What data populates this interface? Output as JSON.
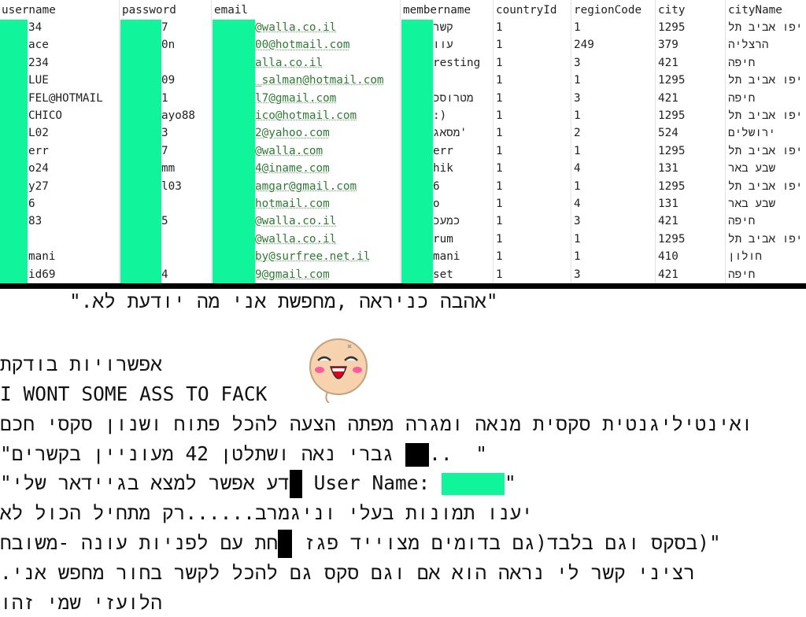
{
  "table": {
    "columns": [
      "username",
      "password",
      "email",
      "membername",
      "countryId",
      "regionCode",
      "city",
      "cityName"
    ],
    "rows": [
      [
        "34",
        "7",
        "@walla.co.il",
        "קשר",
        "1",
        "1",
        "1295",
        "תל אביב יפו"
      ],
      [
        "ace",
        "0n",
        "00@hotmail.com",
        "עוו",
        "1",
        "249",
        "379",
        "הרצליה"
      ],
      [
        "234",
        "",
        "alla.co.il",
        "resting",
        "1",
        "3",
        "421",
        "חיפה"
      ],
      [
        "LUE",
        "09",
        "_salman@hotmail.com",
        "",
        "1",
        "1",
        "1295",
        "תל אביב יפו"
      ],
      [
        "FEL@HOTMAIL",
        "1",
        "l7@gmail.com",
        "מטרוסכ",
        "1",
        "3",
        "421",
        "חיפה"
      ],
      [
        "CHICO",
        "ayo88",
        "ico@hotmail.com",
        ":)",
        "1",
        "1",
        "1295",
        "תל אביב יפו"
      ],
      [
        "L02",
        "3",
        "2@yahoo.com",
        "מסאג'",
        "1",
        "2",
        "524",
        "ירושלים"
      ],
      [
        "err",
        "7",
        "@walla.com",
        "err",
        "1",
        "1",
        "1295",
        "תל אביב יפו"
      ],
      [
        "o24",
        "mm",
        "4@iname.com",
        "hik",
        "1",
        "4",
        "131",
        "באר שבע"
      ],
      [
        "y27",
        "l03",
        "amgar@gmail.com",
        "6",
        "1",
        "1",
        "1295",
        "תל אביב יפו"
      ],
      [
        "6",
        "",
        "hotmail.com",
        "o",
        "1",
        "4",
        "131",
        "באר שבע"
      ],
      [
        "83",
        "5",
        "@walla.co.il",
        "כמעכ",
        "1",
        "3",
        "421",
        "חיפה"
      ],
      [
        "",
        "",
        "@walla.co.il",
        "rum",
        "1",
        "1",
        "1295",
        "תל אביב יפו"
      ],
      [
        "mani",
        "",
        "by@surfree.net.il",
        "mani",
        "1",
        "1",
        "410",
        "חולון"
      ],
      [
        "id69",
        "4",
        "9@gmail.com",
        "set",
        "1",
        "3",
        "421",
        "חיפה"
      ]
    ]
  },
  "profile_texts": {
    "line1": "\".לא יודעת מה אני מחפשת, כניראה אהבה\"",
    "line2": "בודקת אפשרויות",
    "line3": "I WONT SOME ASS TO FACK",
    "line4": "חכם סקסי ושנון פתוח להכל הצעה מפתה ומגרה מנאה סקסית ואינטיליגנטית",
    "line5a": "\"בקשרים מעוניין 42 ושתלטן נאה גברי",
    "line5b": "..  \"",
    "line6a": "\"שלי בגיידאר למצא אפשר דע",
    "line6b": "User Name:",
    "line6c": "\"",
    "line7": "לא הכול מתחיל וניגמרב......רק בעלי תמונות יענו",
    "line8a": "משובח- עונה לפניות עם חת",
    "line8b": "פגז מצוייד בדומים בלבד(גם וגם בסקס)\"",
    "line9": ".אני מחפש בחור לקשר להכל גם סקס וגם אם הוא נראה לי קשר רציני",
    "line10": "זהו שמי הלועזי"
  },
  "colors": {
    "redaction_green": "#10f59b",
    "redaction_black": "#000000",
    "email_link": "#2f7a34"
  },
  "icons": {
    "sticker": "laughing-face-sticker"
  }
}
